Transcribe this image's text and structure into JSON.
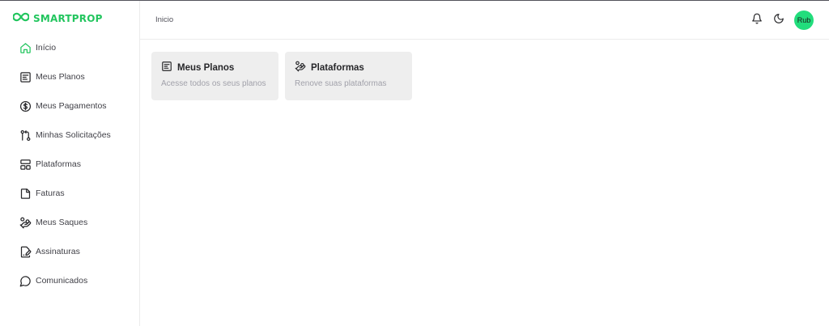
{
  "brand": {
    "name": "SMARTPROP",
    "color": "#22c55e",
    "icon": "infinity-logo-icon"
  },
  "sidebar": {
    "items": [
      {
        "label": "Início",
        "icon": "home-icon",
        "active": true
      },
      {
        "label": "Meus Planos",
        "icon": "plans-list-icon"
      },
      {
        "label": "Meus Pagamentos",
        "icon": "dollar-circle-icon"
      },
      {
        "label": "Minhas Solicitações",
        "icon": "git-pull-request-icon"
      },
      {
        "label": "Plataformas",
        "icon": "layout-icon"
      },
      {
        "label": "Faturas",
        "icon": "sticky-note-icon"
      },
      {
        "label": "Meus Saques",
        "icon": "hand-coins-icon"
      },
      {
        "label": "Assinaturas",
        "icon": "file-signature-icon"
      },
      {
        "label": "Comunicados",
        "icon": "message-circle-icon"
      }
    ]
  },
  "header": {
    "breadcrumb": "Inicio",
    "avatar_text": "Rub",
    "avatar_color": "#22dd7c"
  },
  "cards": [
    {
      "title": "Meus Planos",
      "description": "Acesse todos os seus planos",
      "icon": "plans-list-icon"
    },
    {
      "title": "Plataformas",
      "description": "Renove suas plataformas",
      "icon": "hand-coins-icon"
    }
  ]
}
